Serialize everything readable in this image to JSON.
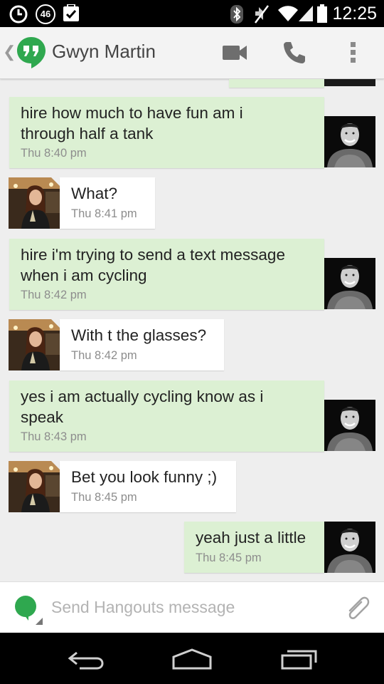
{
  "status_bar": {
    "time": "12:25",
    "notification_count": "46",
    "icons": [
      "alarm-icon",
      "notification-count-badge",
      "briefcase-icon",
      "bluetooth-icon",
      "mute-icon",
      "wifi-icon",
      "signal-icon",
      "battery-icon"
    ]
  },
  "action_bar": {
    "contact_name": "Gwyn Martin",
    "icons": [
      "up-chevron-icon",
      "hangouts-logo",
      "video-call-icon",
      "phone-call-icon",
      "overflow-menu-icon"
    ]
  },
  "messages": [
    {
      "direction": "out",
      "lines": [
        "hire how much to have fun am i",
        "through half a tank"
      ],
      "time": "Thu 8:40 pm"
    },
    {
      "direction": "in",
      "lines": [
        "What?"
      ],
      "time": "Thu 8:41 pm"
    },
    {
      "direction": "out",
      "lines": [
        "hire i'm trying to send a text message",
        "when i am cycling"
      ],
      "time": "Thu 8:42 pm"
    },
    {
      "direction": "in",
      "lines": [
        "With t the glasses?"
      ],
      "time": "Thu 8:42 pm"
    },
    {
      "direction": "out",
      "lines": [
        "yes i am actually cycling know as i",
        "speak"
      ],
      "time": "Thu 8:43 pm"
    },
    {
      "direction": "in",
      "lines": [
        "Bet you look funny ;)"
      ],
      "time": "Thu 8:45 pm"
    },
    {
      "direction": "out",
      "lines": [
        "yeah just a little"
      ],
      "time": "Thu 8:45 pm"
    }
  ],
  "composer": {
    "placeholder": "Send Hangouts message",
    "icons": [
      "hangouts-status-icon",
      "attach-icon"
    ]
  },
  "nav_bar": {
    "icons": [
      "back-icon",
      "home-icon",
      "recents-icon"
    ]
  },
  "colors": {
    "outgoing_bubble": "#dcf0d3",
    "incoming_bubble": "#ffffff",
    "hangouts_green": "#2fa84f",
    "background": "#eeeeee"
  }
}
